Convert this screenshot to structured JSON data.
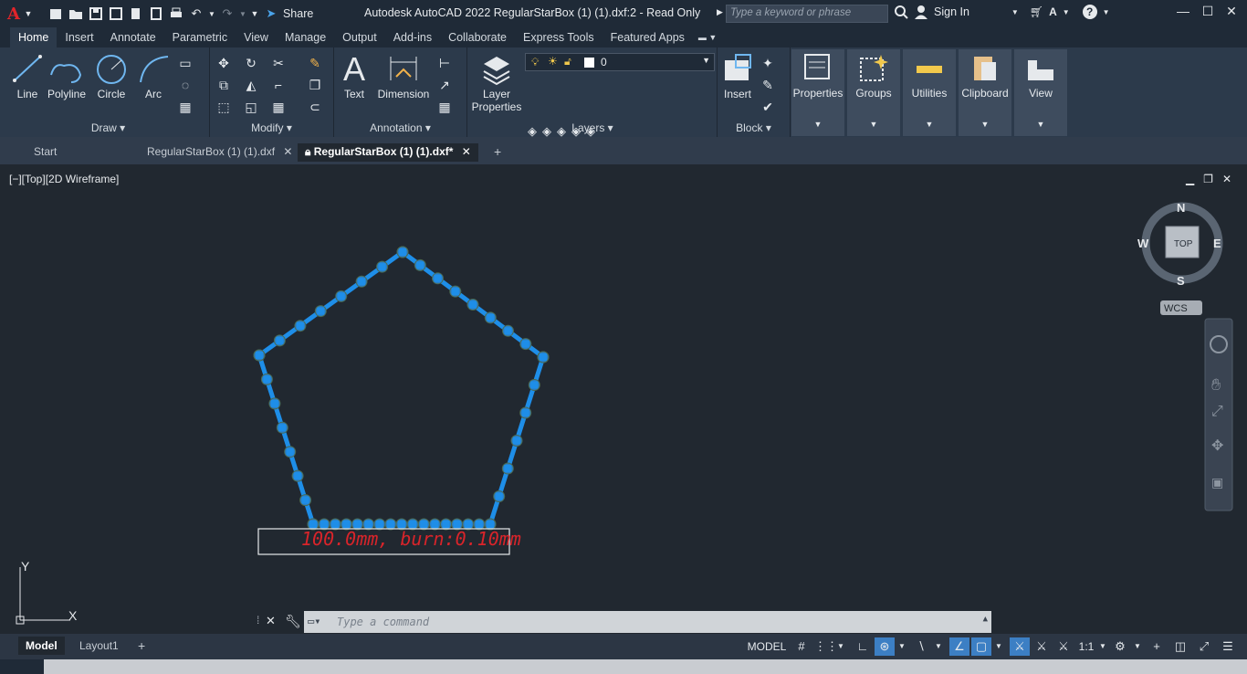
{
  "app": {
    "title": "Autodesk AutoCAD 2022    RegularStarBox (1) (1).dxf:2 - Read Only",
    "share_label": "Share",
    "search_placeholder": "Type a keyword or phrase",
    "sign_in_label": "Sign In"
  },
  "ribbon": {
    "tabs": [
      "Home",
      "Insert",
      "Annotate",
      "Parametric",
      "View",
      "Manage",
      "Output",
      "Add-ins",
      "Collaborate",
      "Express Tools",
      "Featured Apps"
    ],
    "active_tab": "Home",
    "draw": {
      "title": "Draw",
      "line": "Line",
      "polyline": "Polyline",
      "circle": "Circle",
      "arc": "Arc"
    },
    "modify": {
      "title": "Modify"
    },
    "annotation": {
      "title": "Annotation",
      "text": "Text",
      "dimension": "Dimension"
    },
    "layers": {
      "title": "Layers",
      "layer_properties_1": "Layer",
      "layer_properties_2": "Properties",
      "current_layer": "0"
    },
    "block": {
      "title": "Block",
      "insert": "Insert"
    },
    "properties": "Properties",
    "groups": "Groups",
    "utilities": "Utilities",
    "clipboard": "Clipboard",
    "view": "View"
  },
  "doc_tabs": {
    "start": "Start",
    "file1": "RegularStarBox (1) (1).dxf",
    "file2": "RegularStarBox (1) (1).dxf*"
  },
  "viewport": {
    "label": "[−][Top][2D Wireframe]",
    "drawing_text": "100.0mm, burn:0.10mm",
    "viewcube": {
      "n": "N",
      "s": "S",
      "e": "E",
      "w": "W",
      "face": "TOP",
      "wcs": "WCS"
    },
    "ucs_x": "X",
    "ucs_y": "Y"
  },
  "command": {
    "placeholder": "Type a command"
  },
  "status": {
    "model_tab": "Model",
    "layout1_tab": "Layout1",
    "model_button": "MODEL",
    "scale": "1:1"
  },
  "colors": {
    "selection_blue": "#1e8ee8",
    "text_red": "#d9242a",
    "background": "#212830"
  }
}
